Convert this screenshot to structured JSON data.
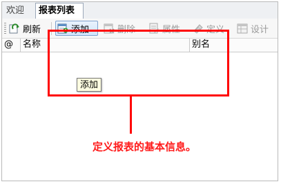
{
  "tabs": [
    {
      "label": "欢迎",
      "active": false
    },
    {
      "label": "报表列表",
      "active": true
    }
  ],
  "toolbar": {
    "refresh": {
      "label": "刷新",
      "icon": "refresh-icon",
      "enabled": true
    },
    "add": {
      "label": "添加",
      "icon": "add-report-icon",
      "enabled": true,
      "hovered": true
    },
    "delete": {
      "label": "删除",
      "icon": "delete-report-icon",
      "enabled": false
    },
    "properties": {
      "label": "属性",
      "icon": "properties-icon",
      "enabled": false
    },
    "define": {
      "label": "定义",
      "icon": "define-icon",
      "enabled": false
    },
    "design": {
      "label": "设计",
      "icon": "design-icon",
      "enabled": false
    }
  },
  "table": {
    "columns": [
      "@",
      "名称",
      "别名"
    ],
    "rows": []
  },
  "tooltip": {
    "text": "添加"
  },
  "annotation": {
    "text": "定义报表的基本信息。",
    "color": "#ff0000"
  }
}
